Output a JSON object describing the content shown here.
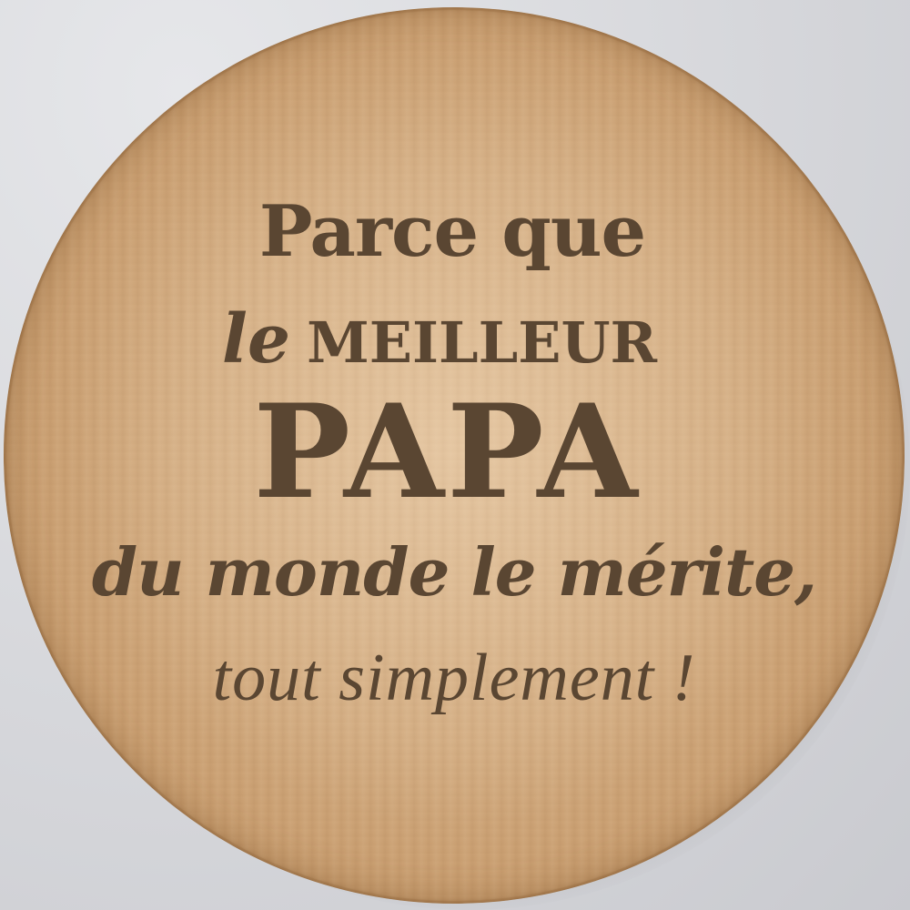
{
  "engraving": {
    "line1": "Parce que",
    "line2_script": "le",
    "line2_caps": "MEILLEUR",
    "line3": "PAPA",
    "line4": "du monde le mérite,",
    "line5": "tout simplement !"
  },
  "colors": {
    "wood": "#d2ab80",
    "ink": "#5a4632",
    "background": "#d8d9dd"
  }
}
